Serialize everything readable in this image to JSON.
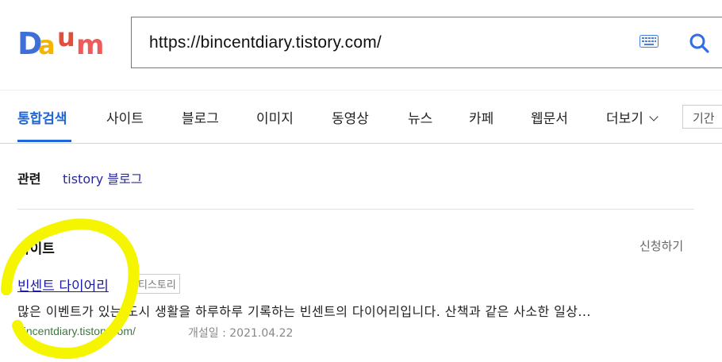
{
  "logo": {
    "text": "Daum"
  },
  "search": {
    "value": "https://bincentdiary.tistory.com/"
  },
  "tabs": [
    {
      "label": "통합검색"
    },
    {
      "label": "사이트"
    },
    {
      "label": "블로그"
    },
    {
      "label": "이미지"
    },
    {
      "label": "동영상"
    },
    {
      "label": "뉴스"
    },
    {
      "label": "카페"
    },
    {
      "label": "웹문서"
    },
    {
      "label": "더보기"
    }
  ],
  "period_filter": {
    "label": "기간"
  },
  "related": {
    "label": "관련",
    "link": "tistory 블로그"
  },
  "site_section": {
    "heading": "사이트",
    "apply_label": "신청하기",
    "result": {
      "title": "빈센트 다이어리",
      "badge": "티스토리",
      "description": "많은 이벤트가 있는 도시 생활을 하루하루 기록하는 빈센트의 다이어리입니다. 산책과 같은 사소한 일상...",
      "url": "bincentdiary.tistory.com/",
      "opened": "개설일 : 2021.04.22"
    }
  },
  "colors": {
    "accent": "#1f66d8",
    "highlight": "#f5f500",
    "link": "#1a1aa8",
    "url": "#3b7a3b"
  }
}
